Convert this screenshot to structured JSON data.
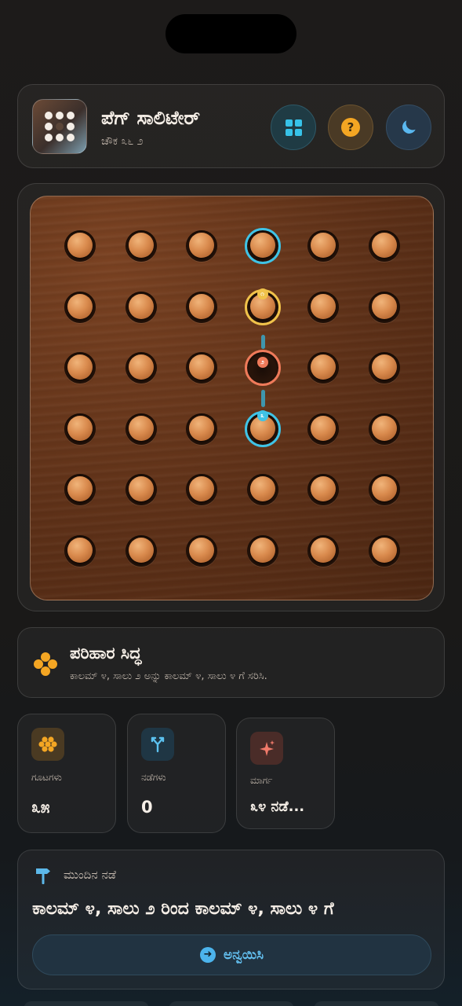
{
  "header": {
    "title": "ಪೆಗ್ ಸಾಲಿಟೇರ್",
    "subtitle": "ಚೌಕ ೩೬ ೨",
    "buttons": [
      "grid-icon",
      "help-icon",
      "moon-icon"
    ],
    "help_glyph": "?"
  },
  "board": {
    "rows": 6,
    "cols": 6,
    "empty_cells": [
      [
        3,
        4
      ]
    ],
    "highlights": [
      {
        "row": 1,
        "col": 4,
        "ring": "cyan",
        "badge": ""
      },
      {
        "row": 2,
        "col": 4,
        "ring": "gold",
        "badge": "೧"
      },
      {
        "row": 3,
        "col": 4,
        "ring": "red",
        "badge": "೨"
      },
      {
        "row": 4,
        "col": 4,
        "ring": "cyan",
        "badge": "೩"
      }
    ],
    "colors": {
      "wood": "#5e3118",
      "peg": "#d98a4d",
      "cyan": "#3fc3e6",
      "gold": "#f0c24a",
      "red": "#ef7a5a"
    }
  },
  "solution": {
    "title": "ಪರಿಹಾರ ಸಿದ್ಧ",
    "description": "ಕಾಲಮ್ ೪, ಸಾಲು ೨ ಅನ್ನು ಕಾಲಮ್ ೪, ಸಾಲು ೪ ಗೆ ಸರಿಸಿ.",
    "icon": "cluster-icon"
  },
  "stats": [
    {
      "label": "ಗೂಟಗಳು",
      "value": "೩೫",
      "icon": "pegs-icon",
      "color": "#f4a623"
    },
    {
      "label": "ನಡೆಗಳು",
      "value": "0",
      "icon": "branch-icon",
      "color": "#5cc2f0"
    },
    {
      "label": "ಮಾರ್ಗ",
      "value": "೩೪ ನಡೆ...",
      "icon": "sparkle-icon",
      "color": "#f07a6a"
    }
  ],
  "next_move": {
    "label": "ಮುಂದಿನ ನಡೆ",
    "text": "ಕಾಲಮ್ ೪, ಸಾಲು ೨ ರಿಂದ ಕಾಲಮ್ ೪, ಸಾಲು ೪ ಗೆ",
    "apply_label": "ಅನ್ವಯಿಸಿ",
    "icon": "signpost-icon"
  }
}
